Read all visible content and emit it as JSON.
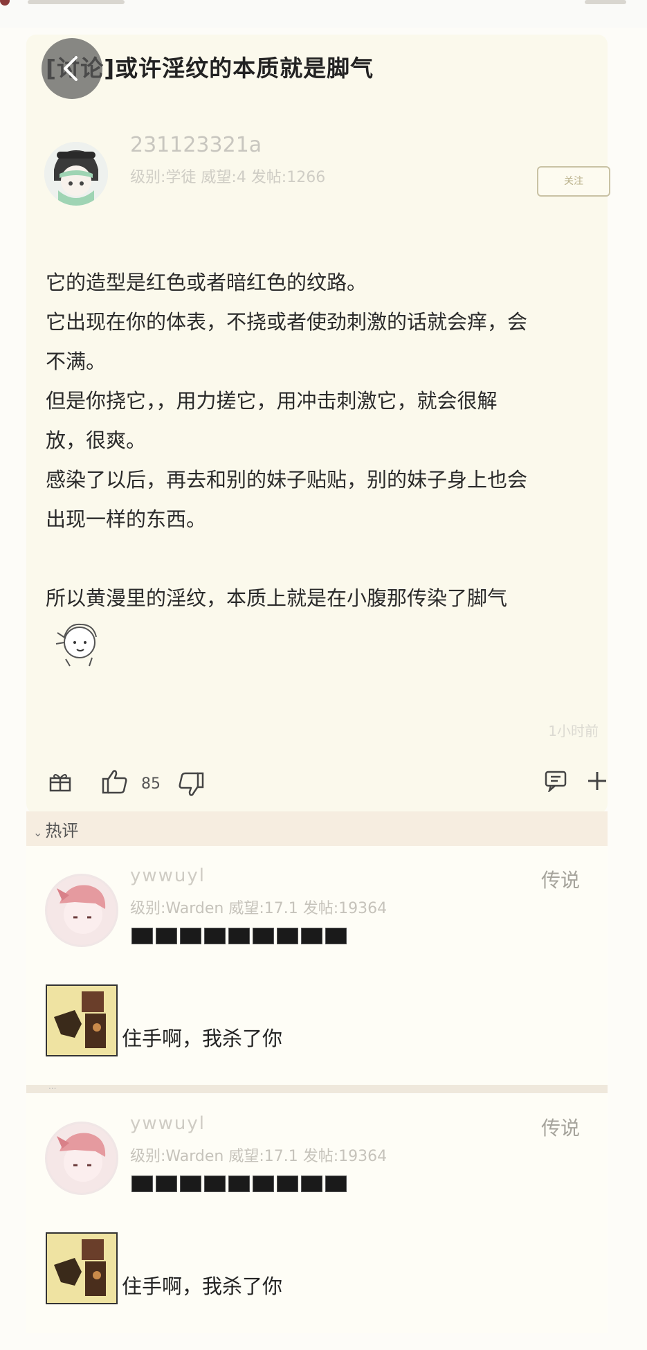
{
  "post": {
    "title": "[讨论]或许淫纹的本质就是脚气",
    "author": {
      "name": "231123321a",
      "meta": "级别:学徒 威望:4 发帖:1266"
    },
    "follow_label": "关注",
    "body": [
      "它的造型是红色或者暗红色的纹路。",
      "它出现在你的体表，不挠或者使劲刺激的话就会痒，会",
      "不满。",
      "但是你挠它，，用力搓它，用冲击刺激它，就会很解",
      "放，很爽。",
      "感染了以后，再去和别的妹子贴贴，别的妹子身上也会",
      "出现一样的东西。",
      "",
      "所以黄漫里的淫纹，本质上就是在小腹那传染了脚气"
    ],
    "time": "1小时前",
    "likes": "85"
  },
  "hot_comments_label": "热评",
  "comments": [
    {
      "name": "ywwuyl",
      "meta": "级别:Warden 威望:17.1 发帖:19364",
      "rank": "传说",
      "text": "住手啊，我杀了你"
    },
    {
      "name": "ywwuyl",
      "meta": "级别:Warden 威望:17.1 发帖:19364",
      "rank": "传说",
      "text": "住手啊，我杀了你"
    }
  ],
  "colors": {
    "page_bg": "#fdfcf8",
    "card_bg": "#fbf9ec",
    "hot_bar": "#f6ede0"
  }
}
